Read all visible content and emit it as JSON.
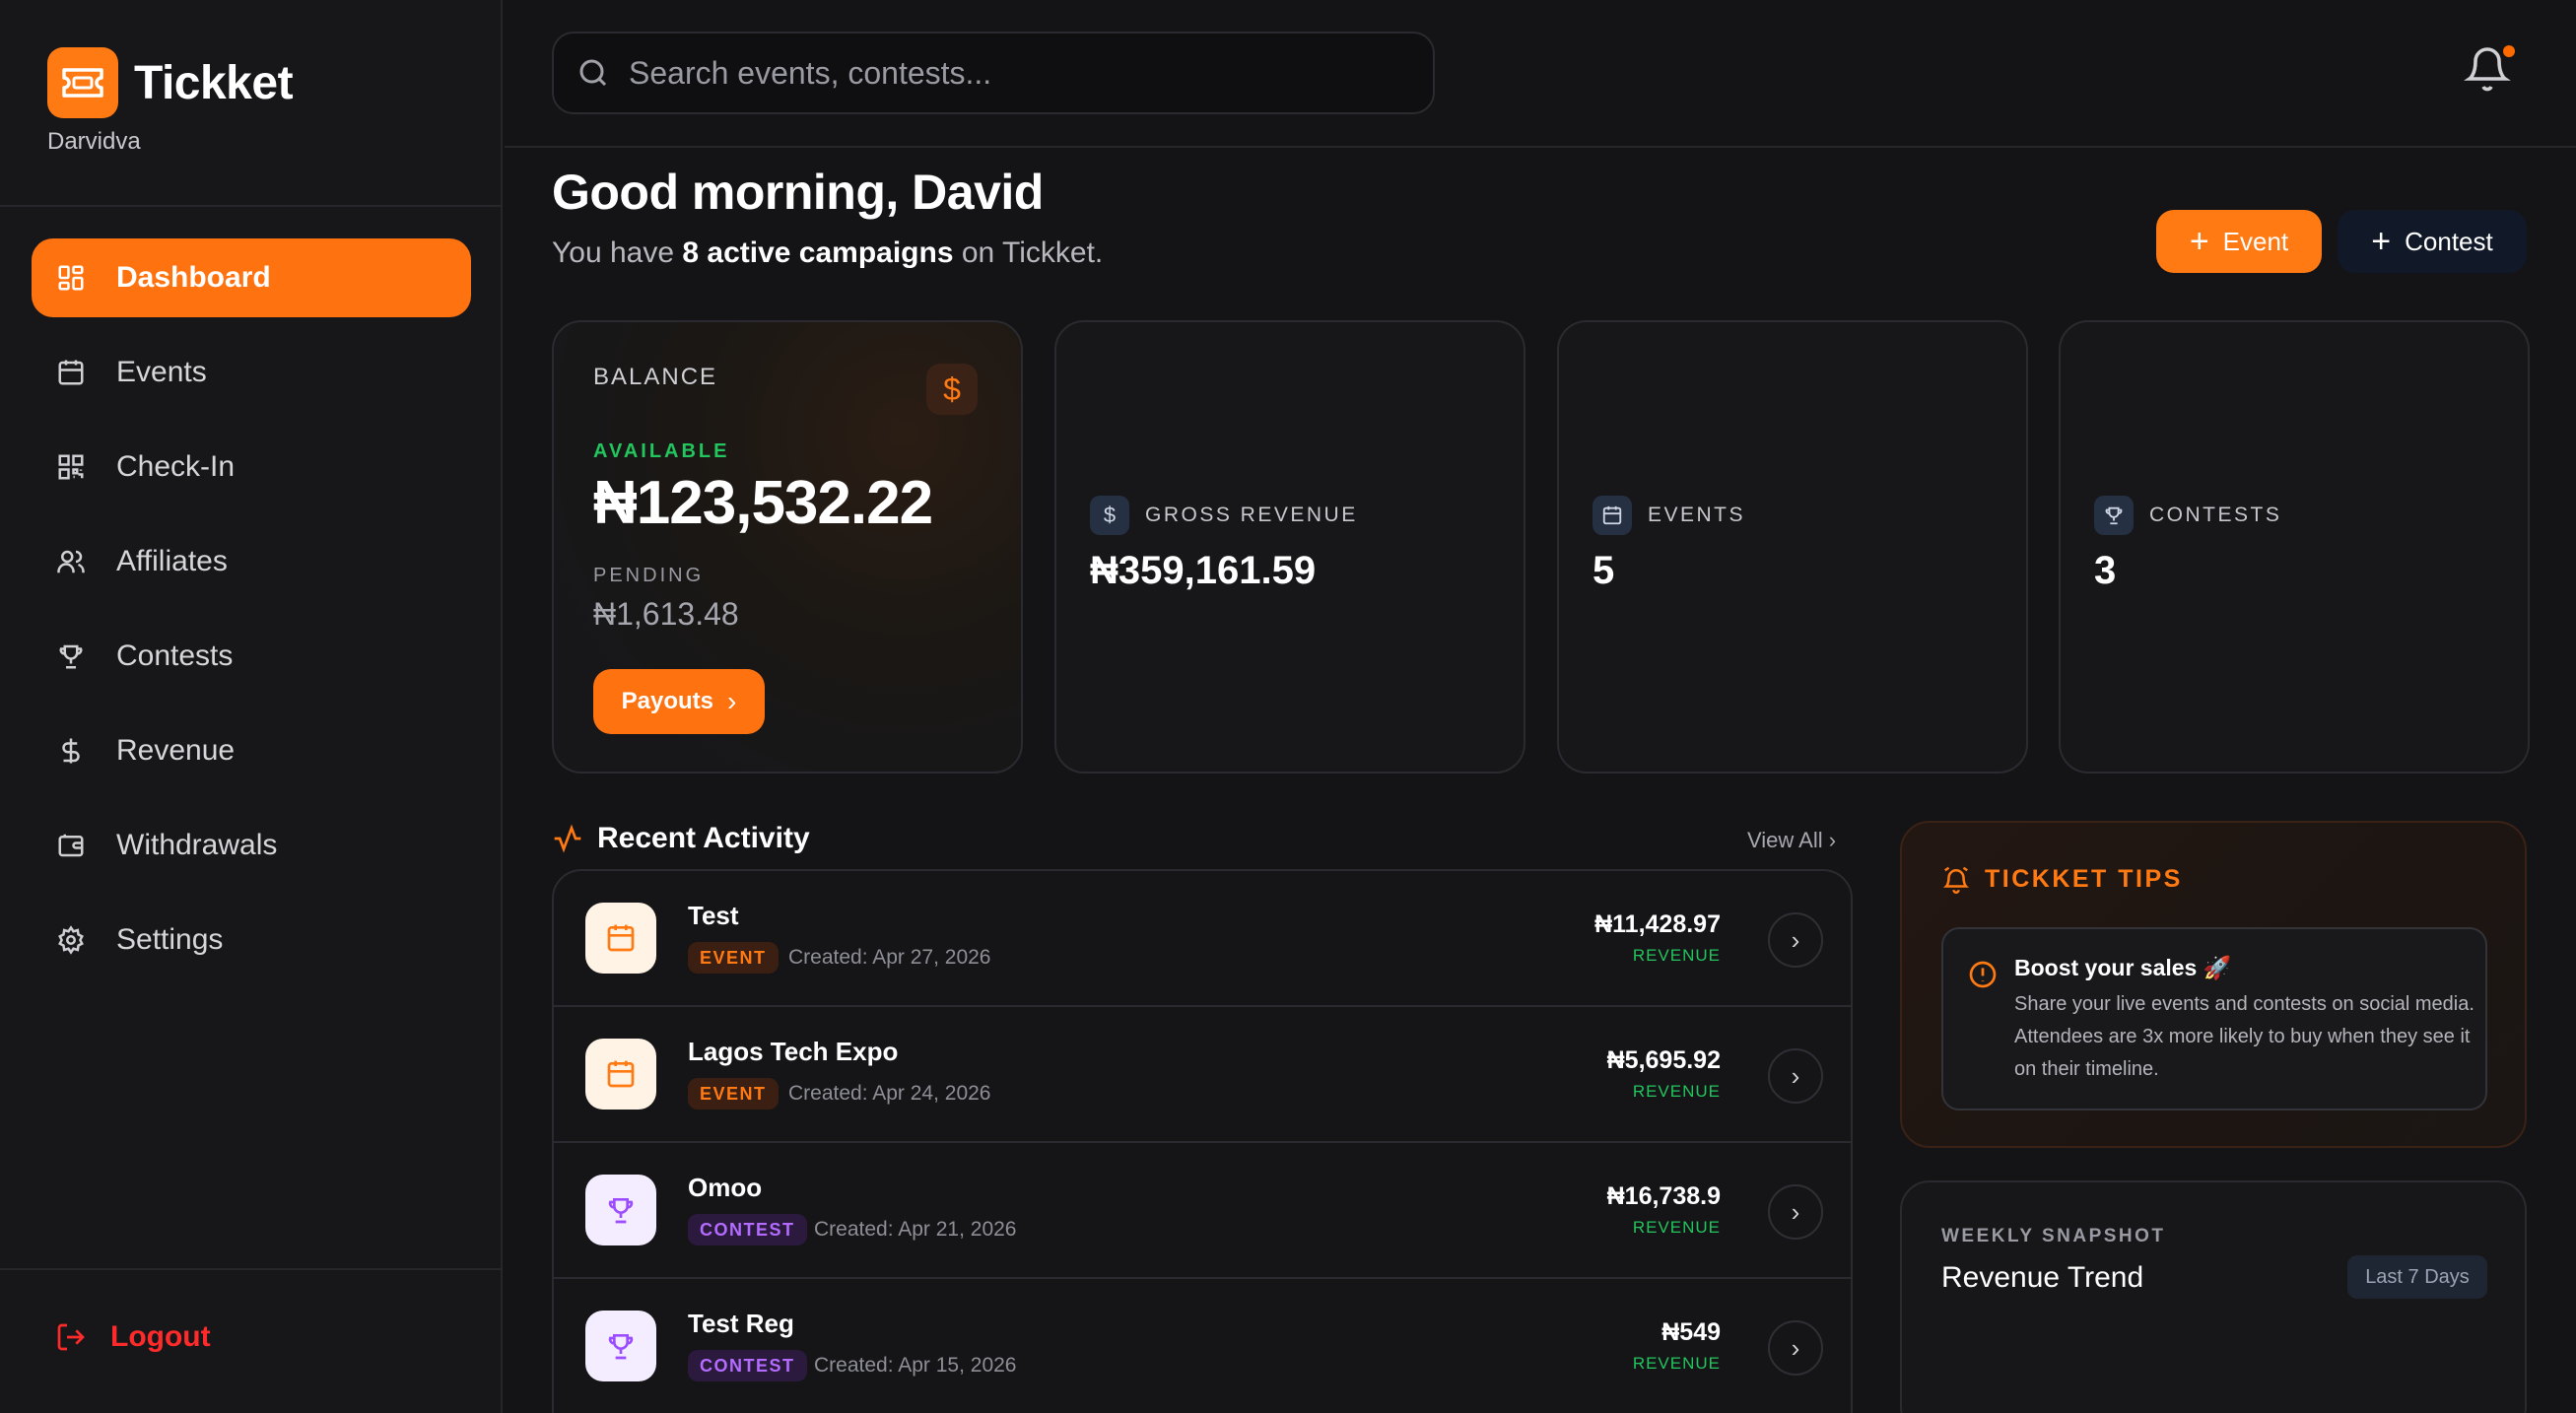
{
  "app": {
    "name": "Tickket",
    "user_handle": "Darvidva"
  },
  "search": {
    "placeholder": "Search events, contests..."
  },
  "sidebar": {
    "items": [
      {
        "label": "Dashboard",
        "icon": "grid-icon",
        "active": true
      },
      {
        "label": "Events",
        "icon": "calendar-icon"
      },
      {
        "label": "Check-In",
        "icon": "qr-icon"
      },
      {
        "label": "Affiliates",
        "icon": "users-icon"
      },
      {
        "label": "Contests",
        "icon": "trophy-icon"
      },
      {
        "label": "Revenue",
        "icon": "dollar-icon"
      },
      {
        "label": "Withdrawals",
        "icon": "wallet-icon"
      },
      {
        "label": "Settings",
        "icon": "gear-icon"
      }
    ],
    "logout_label": "Logout"
  },
  "header": {
    "greeting": "Good morning, David",
    "sub_prefix": "You have ",
    "sub_bold": "8 active campaigns",
    "sub_suffix": " on Tickket.",
    "event_button": "Event",
    "contest_button": "Contest"
  },
  "balance": {
    "label": "BALANCE",
    "available_label": "AVAILABLE",
    "available_value": "₦123,532.22",
    "pending_label": "PENDING",
    "pending_value": "₦1,613.48",
    "payouts_label": "Payouts"
  },
  "stats": [
    {
      "label": "GROSS REVENUE",
      "value": "₦359,161.59",
      "icon": "dollar-icon"
    },
    {
      "label": "EVENTS",
      "value": "5",
      "icon": "calendar-icon"
    },
    {
      "label": "CONTESTS",
      "value": "3",
      "icon": "trophy-icon"
    }
  ],
  "activity": {
    "title": "Recent Activity",
    "view_all": "View All",
    "items": [
      {
        "name": "Test",
        "type": "EVENT",
        "created": "Created: Apr 27, 2026",
        "amount": "₦11,428.97",
        "amount_label": "REVENUE"
      },
      {
        "name": "Lagos Tech Expo",
        "type": "EVENT",
        "created": "Created: Apr 24, 2026",
        "amount": "₦5,695.92",
        "amount_label": "REVENUE"
      },
      {
        "name": "Omoo",
        "type": "CONTEST",
        "created": "Created: Apr 21, 2026",
        "amount": "₦16,738.9",
        "amount_label": "REVENUE"
      },
      {
        "name": "Test Reg",
        "type": "CONTEST",
        "created": "Created: Apr 15, 2026",
        "amount": "₦549",
        "amount_label": "REVENUE"
      }
    ]
  },
  "tips": {
    "title": "TICKKET TIPS",
    "tip_title": "Boost your sales 🚀",
    "tip_body": "Share your live events and contests on social media. Attendees are 3x more likely to buy when they see it on their timeline."
  },
  "weekly": {
    "label": "WEEKLY SNAPSHOT",
    "title": "Revenue Trend",
    "range": "Last 7 Days"
  },
  "colors": {
    "accent": "#ff7210",
    "success": "#22c55e",
    "danger": "#ff2b2b",
    "contest": "#b36cff"
  }
}
